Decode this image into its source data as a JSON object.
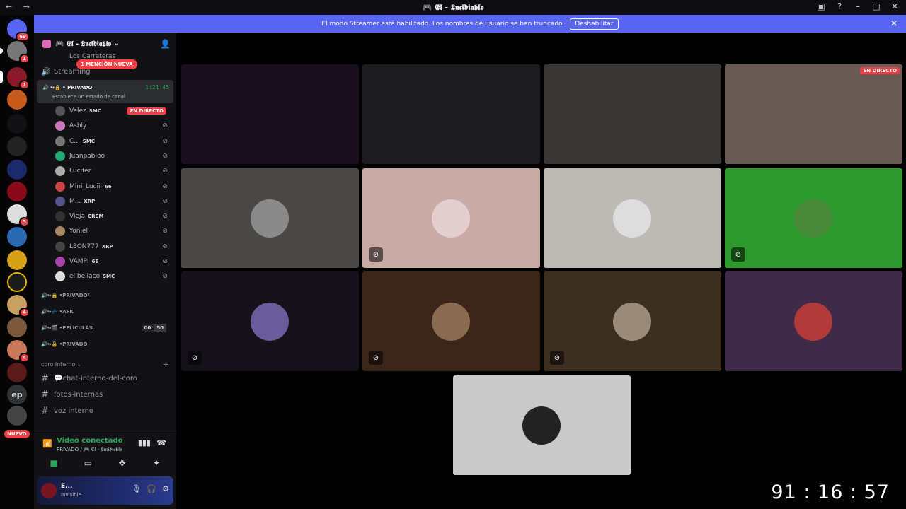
{
  "window": {
    "title": "🎮 𝕰𝖑 - 𝕷𝖚𝖈𝖎𝖉𝖎𝖆𝖇𝖑𝖔",
    "nav_icons": "← →"
  },
  "servers": {
    "home_badge": "69",
    "badges": [
      "1",
      "1",
      "3",
      "4",
      "4"
    ],
    "text_server": "ep",
    "new_label": "NUEVO"
  },
  "banner": {
    "message": "El modo Streamer está habilitado. Los nombres de usuario se han truncado.",
    "button": "Deshabilitar"
  },
  "guild": {
    "name": "🎮 𝕰𝖑 - 𝕷𝖚𝖈𝖎𝖉𝖎𝖆𝖇𝖑𝖔",
    "top_channel": "Los Carreteras",
    "streaming_channel": "Streaming",
    "mention_badge": "1 MENCIÓN NUEVA",
    "active_channel": {
      "name": "PRIVADO",
      "timer": "1:21:45",
      "status": "Establece un estado de canal"
    },
    "members": [
      {
        "name": "Velez",
        "tag": "SMC",
        "live": "EN DIRECTO",
        "color": "#555"
      },
      {
        "name": "Ashly",
        "tag": "",
        "color": "#c7b"
      },
      {
        "name": "C...",
        "tag": "SMC",
        "color": "#777"
      },
      {
        "name": "Juanpabloo",
        "tag": "",
        "color": "#2a7"
      },
      {
        "name": "Lucifer",
        "tag": "",
        "color": "#aaa"
      },
      {
        "name": "Mini_Luciii",
        "tag": "66",
        "color": "#c44"
      },
      {
        "name": "M...",
        "tag": "XRP",
        "color": "#558"
      },
      {
        "name": "Vieja",
        "tag": "CREM",
        "color": "#333"
      },
      {
        "name": "Yoniel",
        "tag": "",
        "color": "#a86"
      },
      {
        "name": "LEON777",
        "tag": "XRP",
        "color": "#444"
      },
      {
        "name": "VAMPI",
        "tag": "66",
        "color": "#a4a"
      },
      {
        "name": "el bellaco",
        "tag": "SMC",
        "color": "#ddd"
      }
    ],
    "voice_channels": [
      {
        "name": "PRIVADO²"
      },
      {
        "name": "AFK"
      },
      {
        "name": "PELICULAS",
        "count_a": "00",
        "count_b": "50"
      },
      {
        "name": "PRIVADO"
      }
    ],
    "category": "coro interno",
    "text_channels": [
      "💬chat-interno-del-coro",
      "fotos-internas",
      "voz interno"
    ]
  },
  "voice_panel": {
    "title": "Video conectado",
    "subtitle": "PRIVADO / 🎮 𝕰𝖑 - 𝕷𝖚𝖈𝖎𝖉𝖎𝖆𝖇𝖑𝖔"
  },
  "user_panel": {
    "name": "E...",
    "status": "Invisible"
  },
  "tiles": [
    {
      "bg": "#1a0f1e",
      "type": "video"
    },
    {
      "bg": "#1c1c1e",
      "type": "video"
    },
    {
      "bg": "#3a3535",
      "type": "video"
    },
    {
      "bg": "#6a5a55",
      "type": "video",
      "live": "EN DIRECTO"
    },
    {
      "bg": "#4a4845",
      "type": "avatar",
      "av": "#8a8a8a"
    },
    {
      "bg": "#c9aaa5",
      "type": "avatar",
      "av": "#e3cfcf",
      "mute": true
    },
    {
      "bg": "#bdbab5",
      "type": "avatar",
      "av": "#ddd"
    },
    {
      "bg": "#2e9a2e",
      "type": "avatar",
      "av": "#4a8a3a",
      "mute": true
    },
    {
      "bg": "#15121a",
      "type": "avatar",
      "av": "#6a5b9a",
      "mute": true
    },
    {
      "bg": "#3a261a",
      "type": "avatar",
      "av": "#8a6a50",
      "mute": true
    },
    {
      "bg": "#3d2e22",
      "type": "avatar",
      "av": "#9a8a7a",
      "mute": true
    },
    {
      "bg": "#3f2a48",
      "type": "avatar",
      "av": "#b33a3a"
    },
    {
      "bg": "#c9c9c9",
      "type": "avatar",
      "av": "#222"
    }
  ],
  "clock": "91 : 16 : 57"
}
